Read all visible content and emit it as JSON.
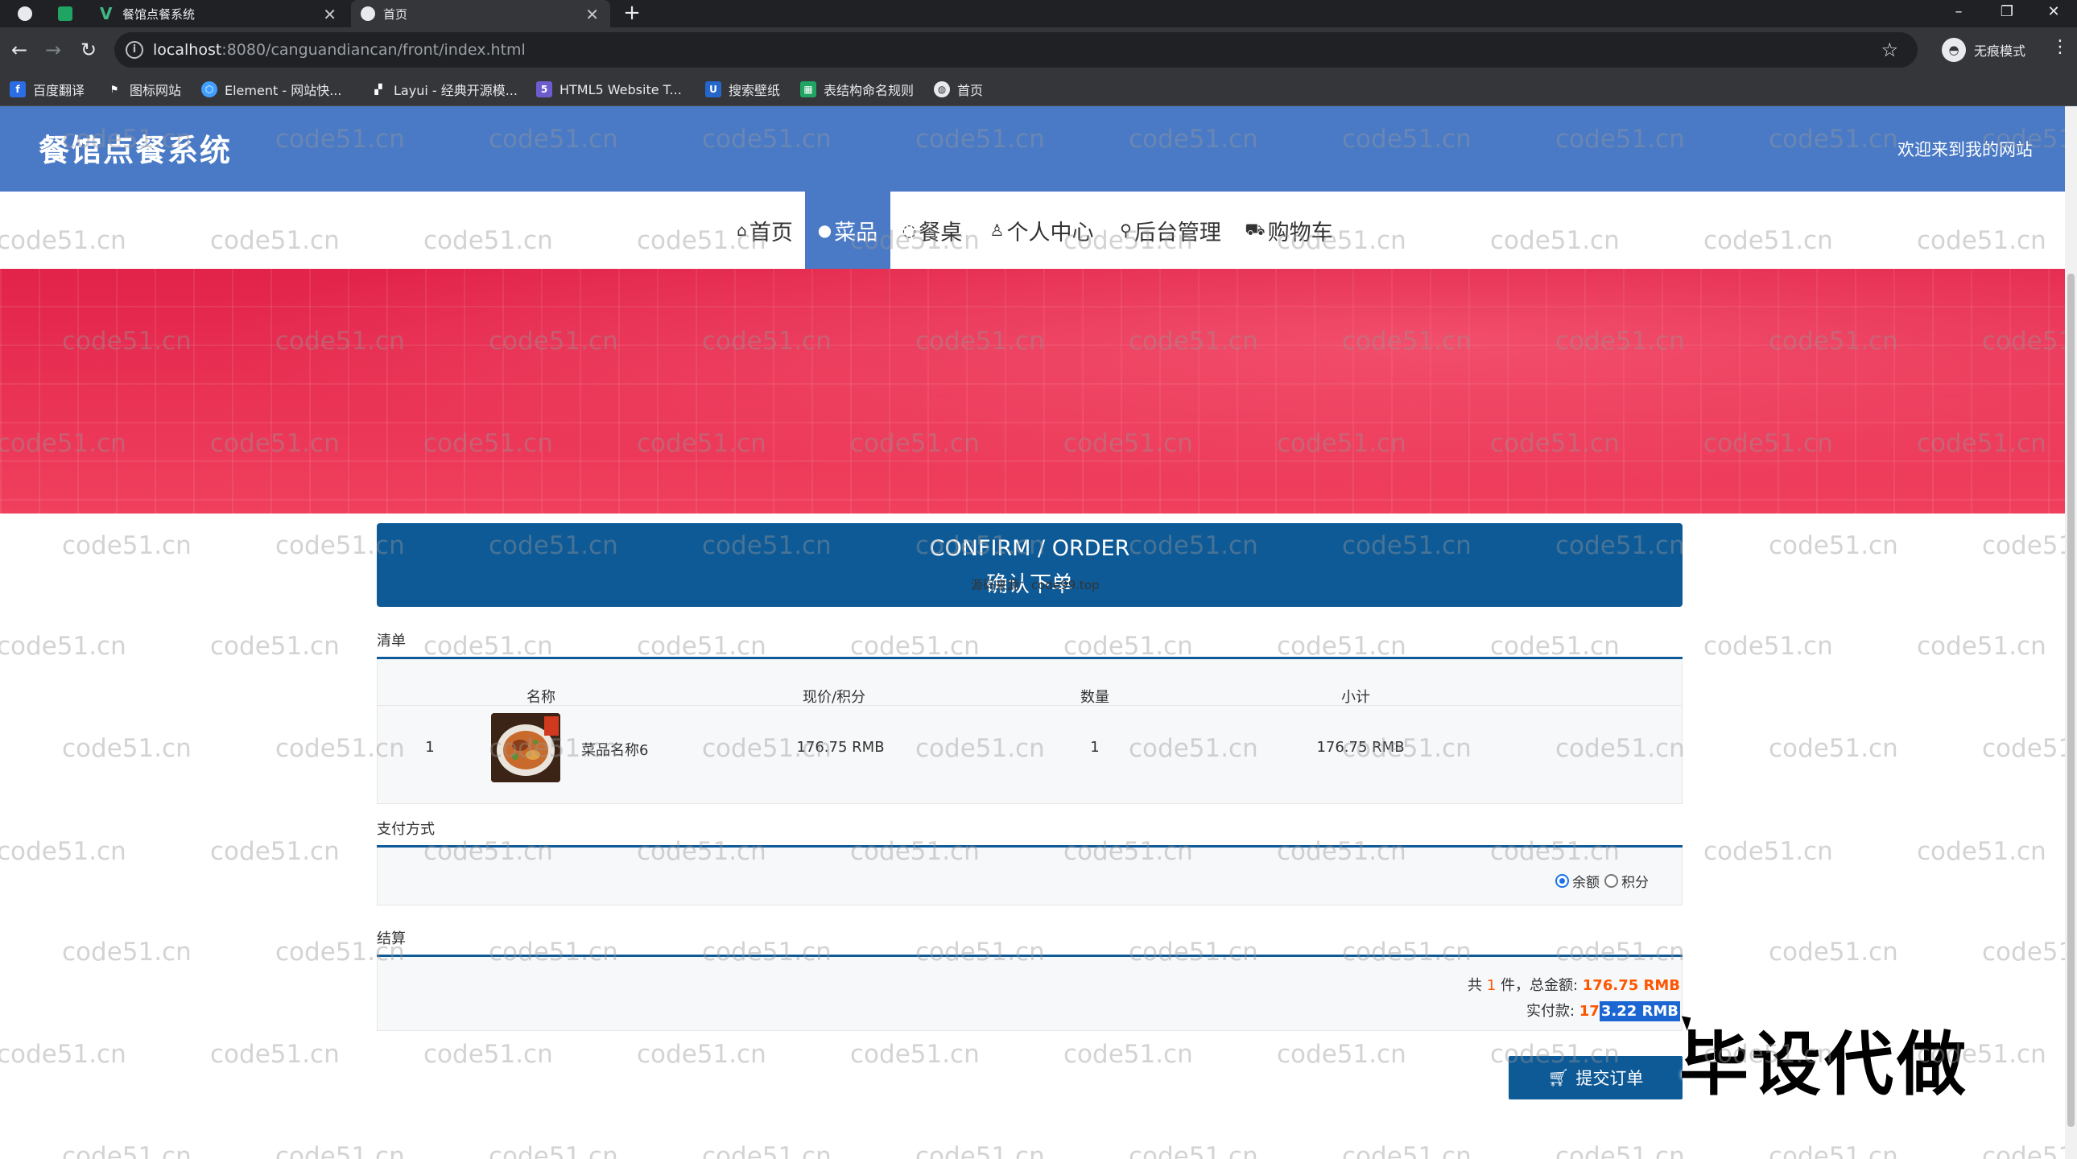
{
  "browser": {
    "tabs": [
      {
        "label": "",
        "icon": "chrome-icon"
      },
      {
        "label": "",
        "icon": "spreadsheet-icon"
      },
      {
        "label": "餐馆点餐系统",
        "icon": "vue-icon",
        "close": "✕"
      },
      {
        "label": "首页",
        "icon": "globe-icon",
        "close": "✕"
      }
    ],
    "new_tab": "+",
    "window_controls": {
      "minimize": "–",
      "restore": "❐",
      "close": "✕"
    },
    "url_host": "localhost",
    "url_path": ":8080/canguandiancan/front/index.html",
    "incognito_label": "无痕模式",
    "bookmarks": [
      {
        "label": "百度翻译",
        "icon": "baidu-translate-icon",
        "color": "#2b6de5"
      },
      {
        "label": "图标网站",
        "icon": "flag-icon",
        "color": "#35363a"
      },
      {
        "label": "Element - 网站快...",
        "icon": "element-icon",
        "color": "#409eff"
      },
      {
        "label": "Layui - 经典开源模...",
        "icon": "layui-icon",
        "color": "#35363a"
      },
      {
        "label": "HTML5 Website T...",
        "icon": "html5-icon",
        "color": "#6e5ccf"
      },
      {
        "label": "搜索壁纸",
        "icon": "wallpaper-icon",
        "color": "#2466c9"
      },
      {
        "label": "表结构命名规则",
        "icon": "sheet-icon",
        "color": "#1fa463"
      },
      {
        "label": "首页",
        "icon": "globe-icon",
        "color": "#35363a"
      }
    ]
  },
  "site": {
    "title": "餐馆点餐系统",
    "welcome": "欢迎来到我的网站",
    "nav": [
      {
        "label": "首页",
        "icon": "⌂",
        "active": false
      },
      {
        "label": "菜品",
        "icon": "●",
        "active": true
      },
      {
        "label": "餐桌",
        "icon": "◌",
        "active": false
      },
      {
        "label": "个人中心",
        "icon": "♙",
        "active": false
      },
      {
        "label": "后台管理",
        "icon": "⚲",
        "active": false
      },
      {
        "label": "购物车",
        "icon": "⛟",
        "active": false
      }
    ],
    "accent_color": "#4a7ac6",
    "banner_color": "#e8294f"
  },
  "order": {
    "confirm_en": "CONFIRM / ORDER",
    "confirm_cn": "确认下单",
    "confirm_source": "源码来源：code99.top",
    "list_label": "清单",
    "columns": [
      "名称",
      "现价/积分",
      "数量",
      "小计"
    ],
    "items": [
      {
        "index": "1",
        "name": "菜品名称6",
        "price": "176.75 RMB",
        "qty": "1",
        "subtotal": "176.75 RMB"
      }
    ],
    "payment_label": "支付方式",
    "payment_options": [
      {
        "label": "余额",
        "checked": true
      },
      {
        "label": "积分",
        "checked": false
      }
    ],
    "settle_label": "结算",
    "summary": {
      "prefix": "共",
      "count": "1",
      "middle": "件，总金额:",
      "total": "176.75 RMB",
      "paid_label": "实付款:",
      "paid_plain": "17",
      "paid_selected": "3.22 RMB"
    },
    "submit_label": "提交订单"
  },
  "overlay": {
    "ad_text": "毕设代做",
    "watermark": "code51.cn"
  }
}
